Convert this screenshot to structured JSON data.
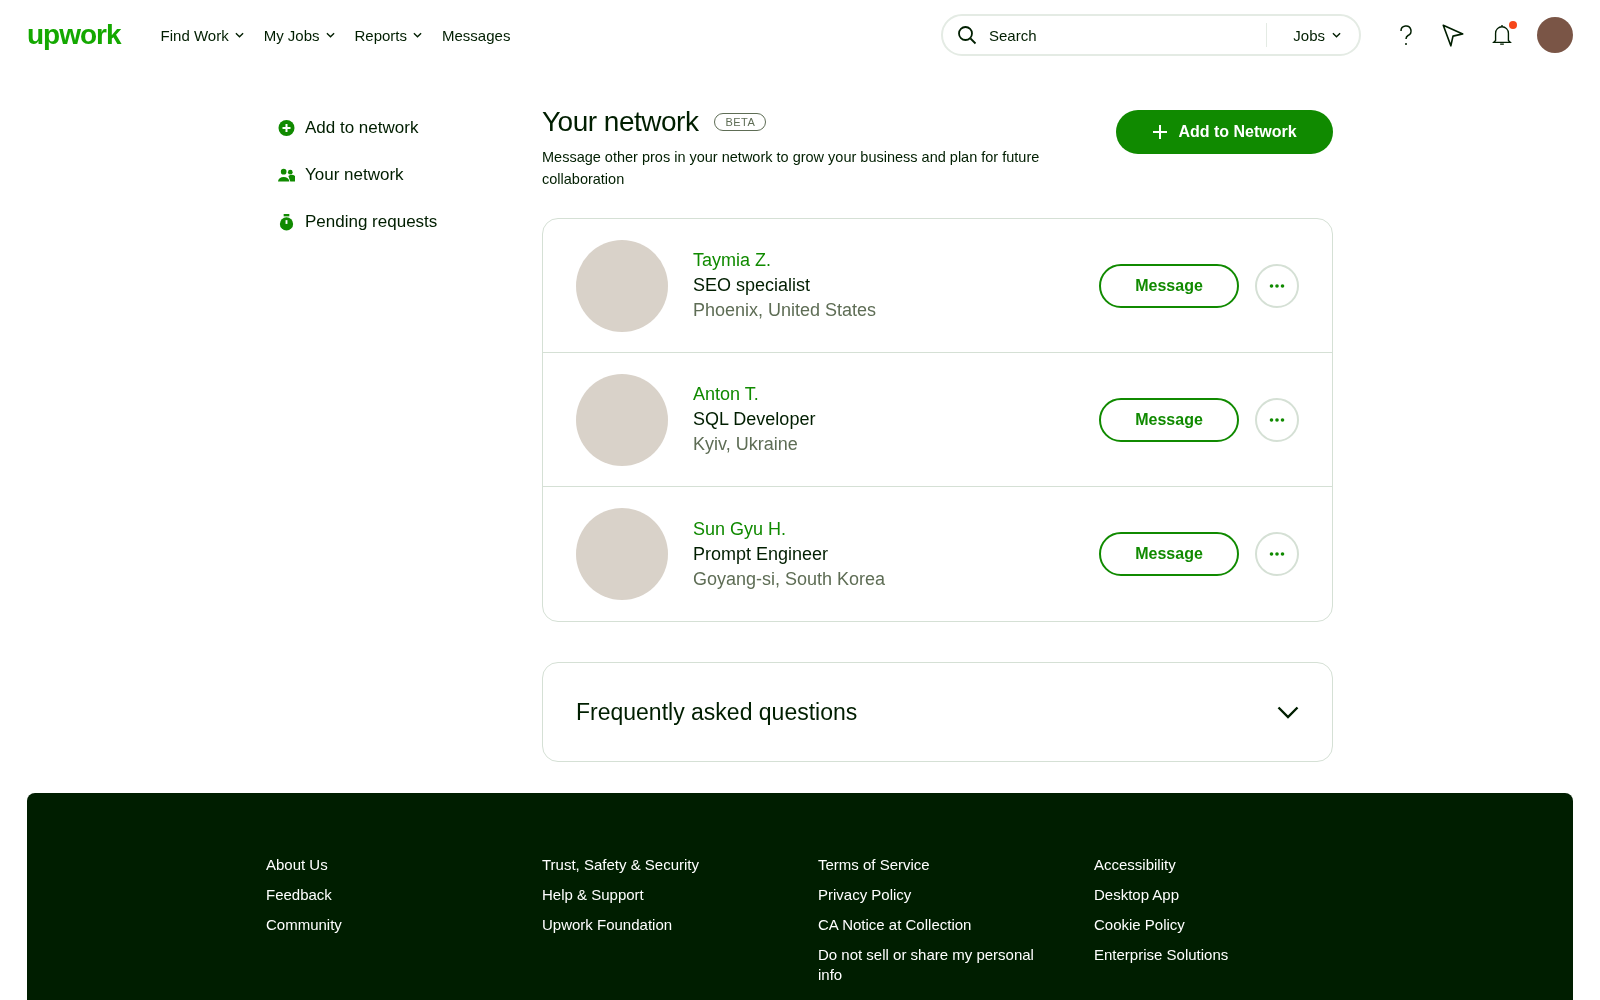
{
  "header": {
    "logo": "upwork",
    "nav": [
      {
        "label": "Find Work",
        "dropdown": true
      },
      {
        "label": "My Jobs",
        "dropdown": true
      },
      {
        "label": "Reports",
        "dropdown": true
      },
      {
        "label": "Messages",
        "dropdown": false
      }
    ],
    "search": {
      "placeholder": "Search",
      "scope": "Jobs"
    },
    "notifications_unread": true
  },
  "sidebar": {
    "items": [
      {
        "label": "Add to network",
        "kind": "add"
      },
      {
        "label": "Your network",
        "kind": "people"
      },
      {
        "label": "Pending requests",
        "kind": "timer"
      }
    ]
  },
  "main": {
    "title": "Your network",
    "badge": "BETA",
    "subtitle": "Message other pros in your network to grow your business and plan for future collaboration",
    "add_button": "Add to Network",
    "connections": [
      {
        "name": "Taymia Z.",
        "title": "SEO specialist",
        "location": "Phoenix, United States",
        "action": "Message"
      },
      {
        "name": "Anton T.",
        "title": "SQL Developer",
        "location": "Kyiv, Ukraine",
        "action": "Message"
      },
      {
        "name": "Sun Gyu H.",
        "title": "Prompt Engineer",
        "location": "Goyang-si, South Korea",
        "action": "Message"
      }
    ],
    "faq": {
      "title": "Frequently asked questions",
      "expanded": false
    }
  },
  "footer": {
    "columns": [
      [
        "About Us",
        "Feedback",
        "Community"
      ],
      [
        "Trust, Safety & Security",
        "Help & Support",
        "Upwork Foundation"
      ],
      [
        "Terms of Service",
        "Privacy Policy",
        "CA Notice at Collection",
        "Do not sell or share my personal info"
      ],
      [
        "Accessibility",
        "Desktop App",
        "Cookie Policy",
        "Enterprise Solutions"
      ]
    ]
  }
}
